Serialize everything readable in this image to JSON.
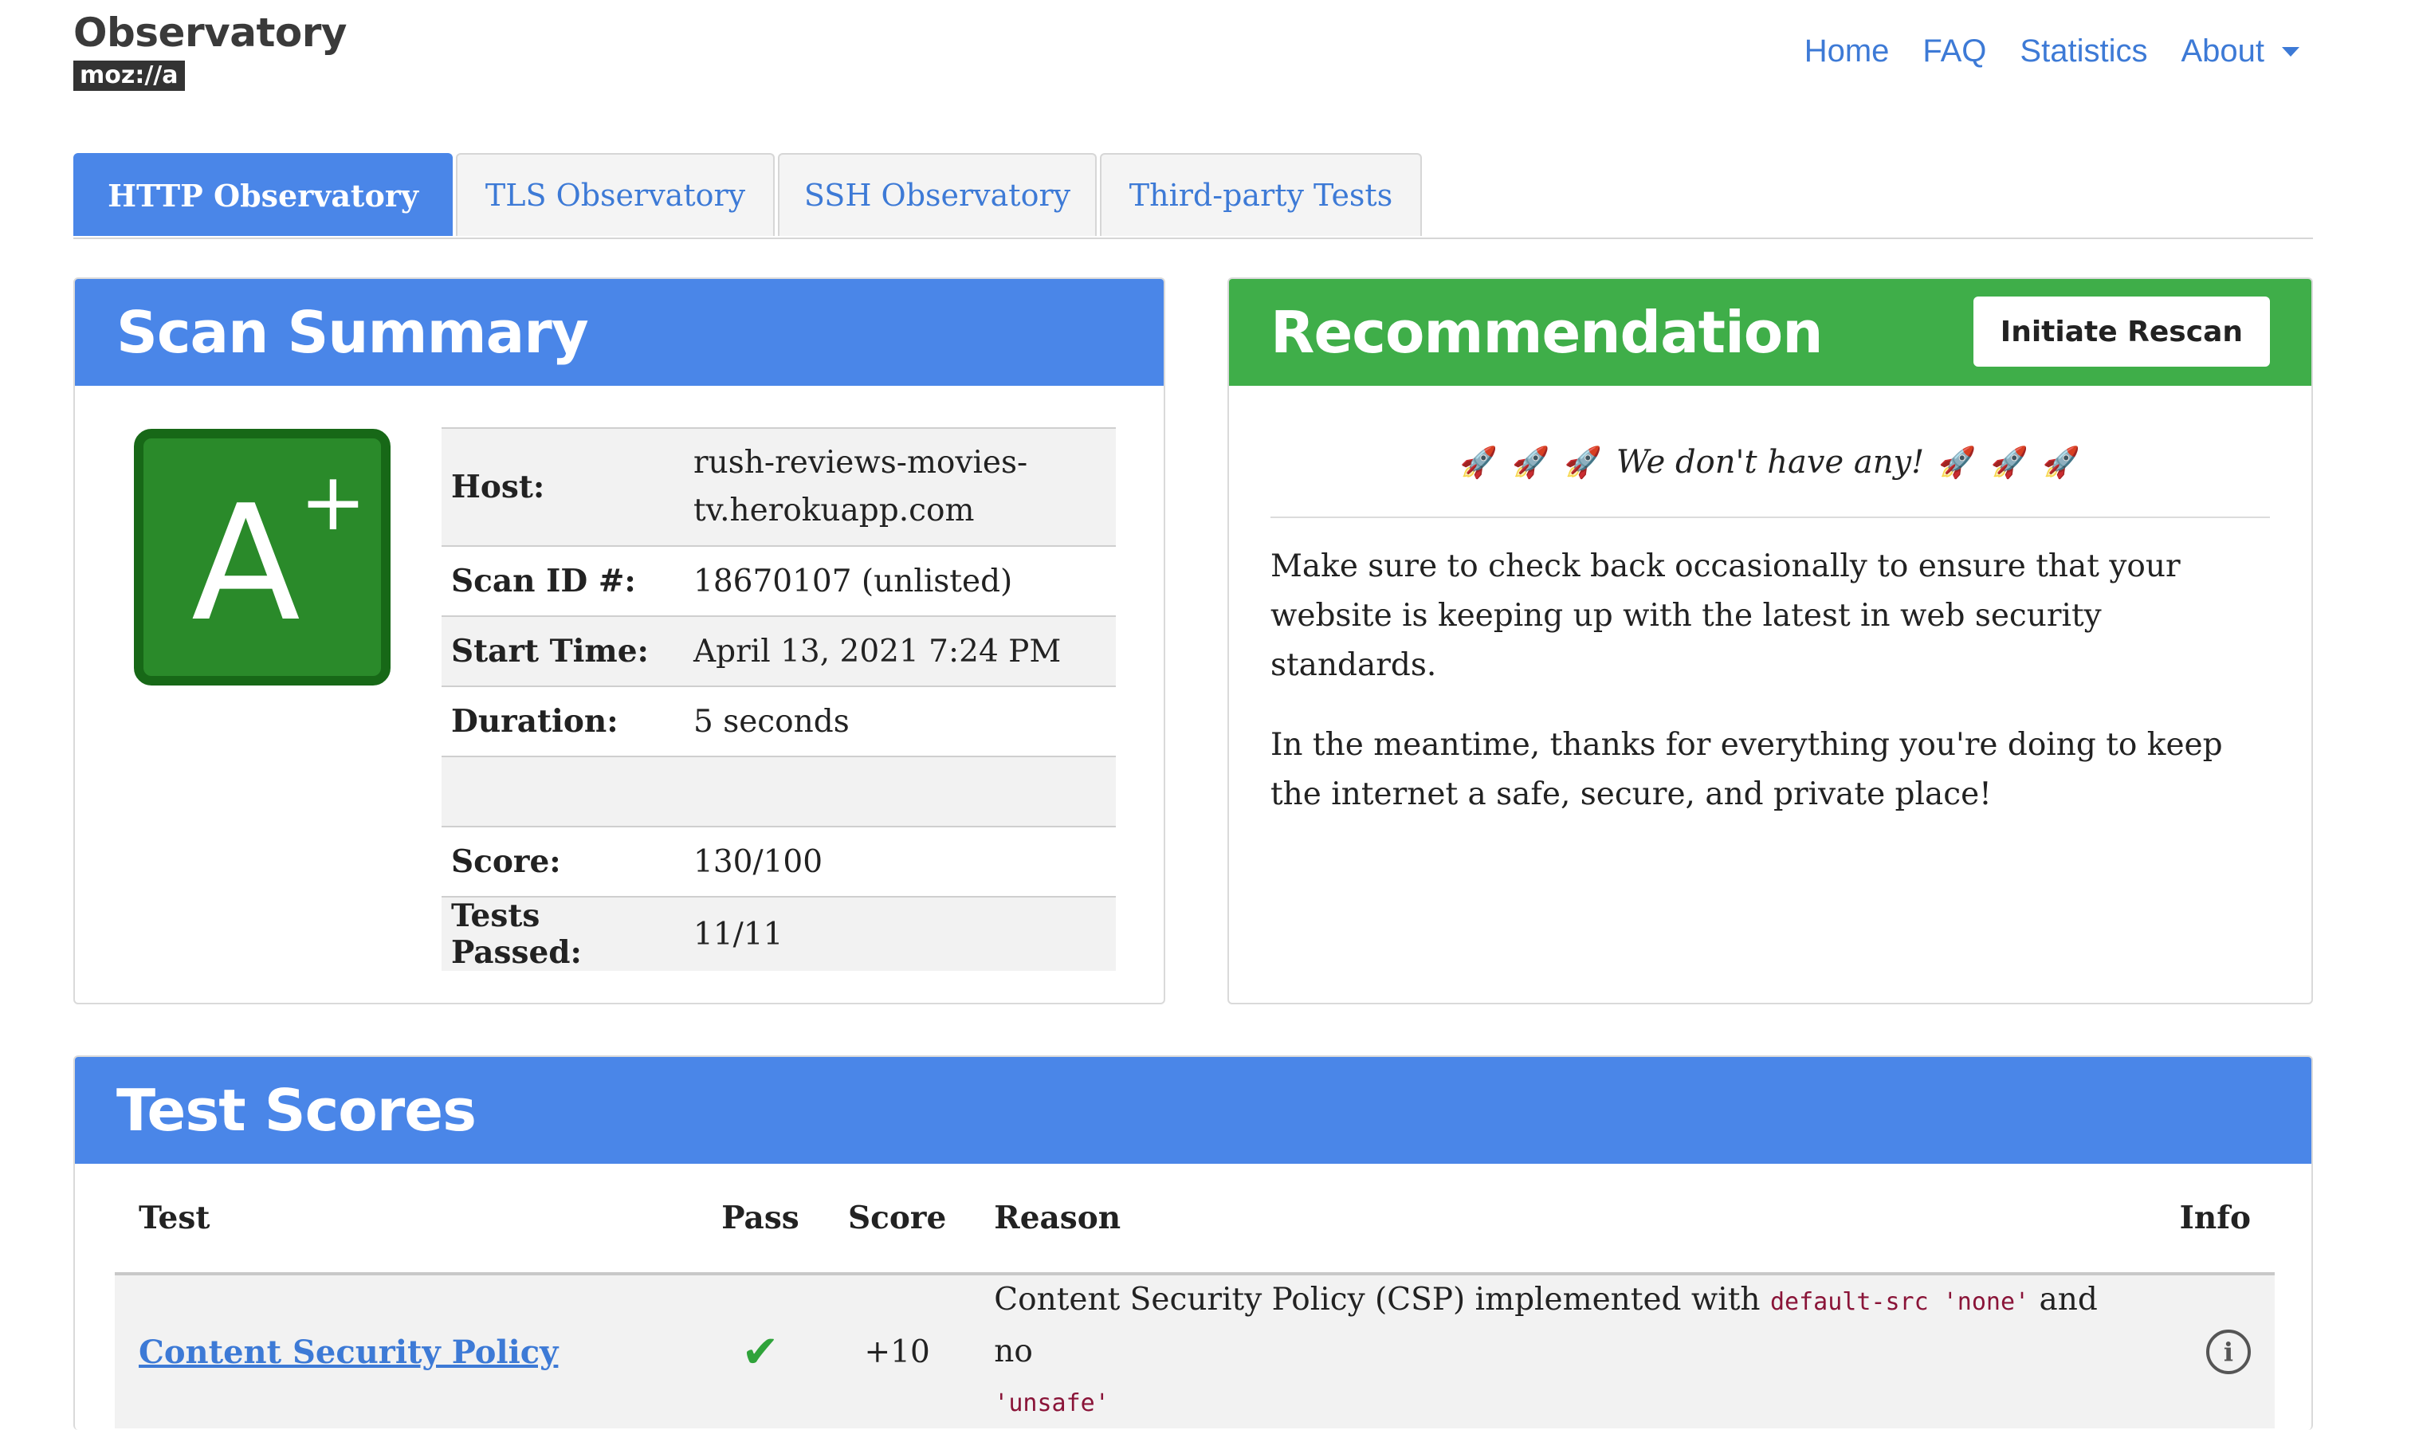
{
  "brand": {
    "title": "Observatory",
    "sub": "moz://a"
  },
  "nav": {
    "home": "Home",
    "faq": "FAQ",
    "statistics": "Statistics",
    "about": "About"
  },
  "tabs": [
    "HTTP Observatory",
    "TLS Observatory",
    "SSH Observatory",
    "Third-party Tests"
  ],
  "summary": {
    "title": "Scan Summary",
    "grade": "A",
    "grade_modifier": "+",
    "rows": [
      {
        "label": "Host:",
        "value": "rush-reviews-movies-tv.herokuapp.com"
      },
      {
        "label": "Scan ID #:",
        "value": "18670107 (unlisted)"
      },
      {
        "label": "Start Time:",
        "value": "April 13, 2021 7:24 PM"
      },
      {
        "label": "Duration:",
        "value": "5 seconds"
      },
      {
        "label": "",
        "value": ""
      },
      {
        "label": "Score:",
        "value": "130/100"
      },
      {
        "label": "Tests Passed:",
        "value": "11/11"
      }
    ]
  },
  "recommendation": {
    "title": "Recommendation",
    "rescan_button": "Initiate Rescan",
    "none_text": "We don't have any!",
    "rocket": "🚀",
    "paragraph1": "Make sure to check back occasionally to ensure that your website is keeping up with the latest in web security standards.",
    "paragraph2": "In the meantime, thanks for everything you're doing to keep the internet a safe, secure, and private place!"
  },
  "scores": {
    "title": "Test Scores",
    "headers": {
      "test": "Test",
      "pass": "Pass",
      "score": "Score",
      "reason": "Reason",
      "info": "Info"
    },
    "rows": [
      {
        "test": "Content Security Policy",
        "pass_icon": "check-icon",
        "score": "+10",
        "reason_prefix": "Content Security Policy (CSP) implemented with",
        "reason_code1": "default-src 'none'",
        "reason_mid": "and no",
        "reason_code2": "'unsafe'"
      }
    ]
  },
  "colors": {
    "accent_blue": "#4a86e8",
    "recommend_green": "#3fae49",
    "grade_green": "#2a8a2a",
    "pass_green": "#2fa33a"
  }
}
